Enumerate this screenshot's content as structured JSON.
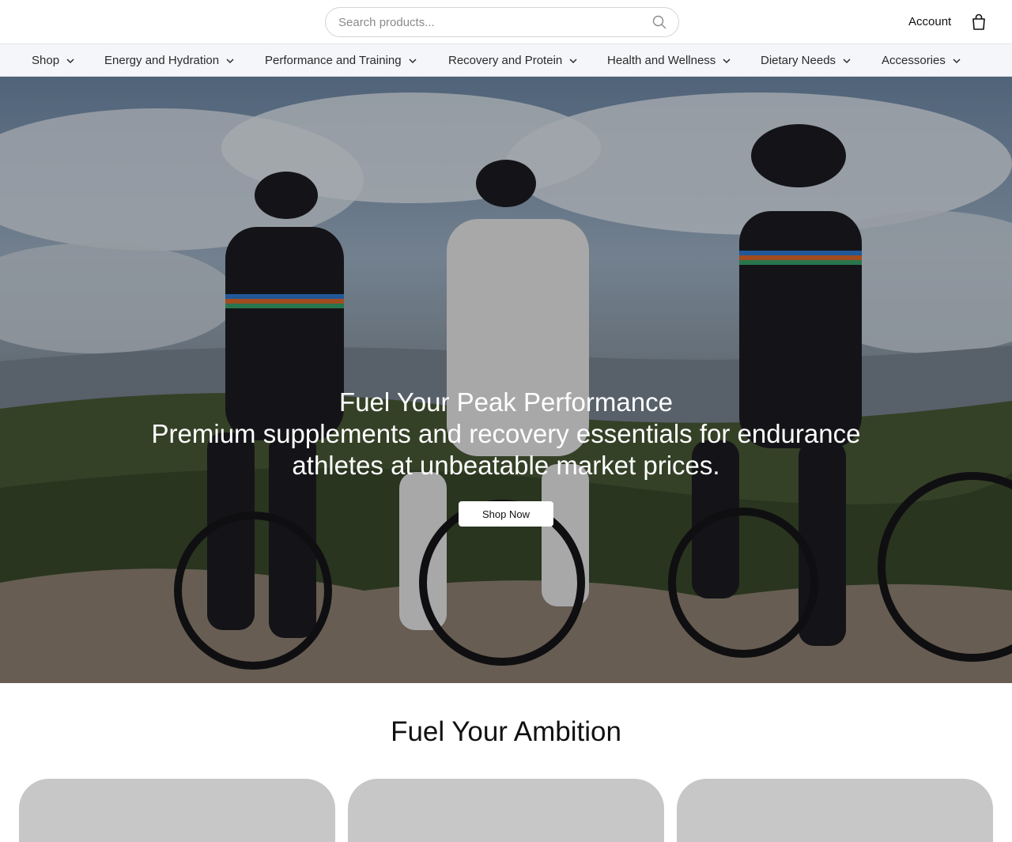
{
  "header": {
    "search_placeholder": "Search products...",
    "account_label": "Account",
    "icons": {
      "search": "search-icon",
      "cart": "shopping-bag-icon"
    }
  },
  "nav": {
    "items": [
      {
        "label": "Shop"
      },
      {
        "label": "Energy and Hydration"
      },
      {
        "label": "Performance and Training"
      },
      {
        "label": "Recovery and Protein"
      },
      {
        "label": "Health and Wellness"
      },
      {
        "label": "Dietary Needs"
      },
      {
        "label": "Accessories"
      }
    ],
    "chevron_icon": "chevron-down-icon"
  },
  "hero": {
    "title": "Fuel Your Peak Performance",
    "subtitle": "Premium supplements and recovery essentials for endurance athletes at unbeatable market prices.",
    "cta_label": "Shop Now"
  },
  "section": {
    "title": "Fuel Your Ambition",
    "cards": [
      {},
      {},
      {}
    ]
  },
  "colors": {
    "nav_background": "#f4f6fa",
    "card_placeholder": "#c7c7c7",
    "hero_text": "#ffffff"
  }
}
